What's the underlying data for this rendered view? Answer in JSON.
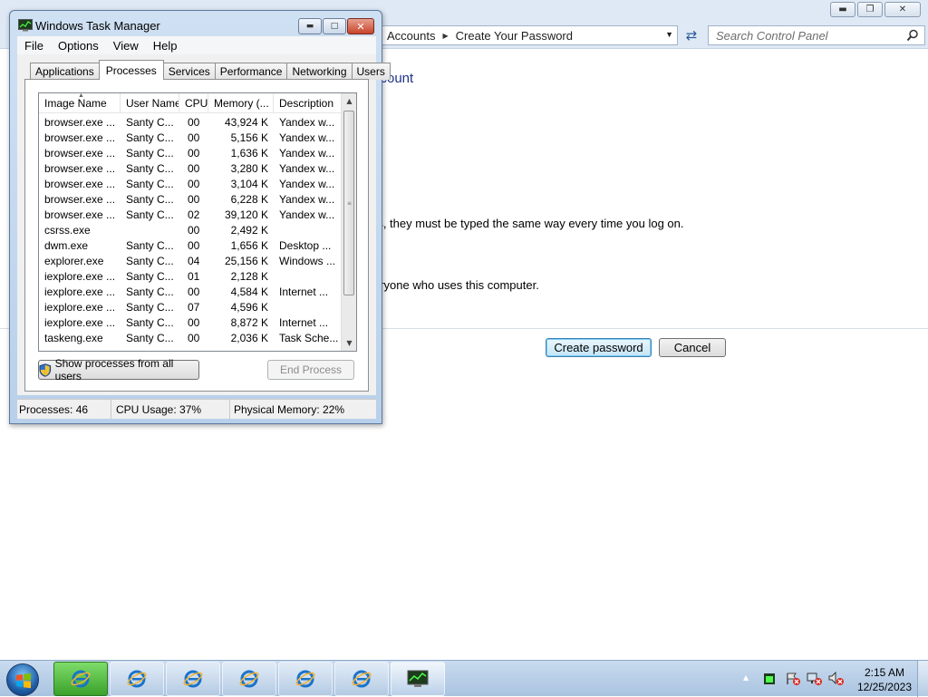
{
  "control_panel": {
    "breadcrumb": [
      "Accounts",
      "Create Your Password"
    ],
    "search_placeholder": "Search Control Panel",
    "heading_fragment": "ccount",
    "text_line1": "rs, they must be typed the same way every time you log on.",
    "text_line2": "eryone who uses this computer.",
    "create_password_label": "Create password",
    "cancel_label": "Cancel"
  },
  "task_manager": {
    "title": "Windows Task Manager",
    "menu": [
      "File",
      "Options",
      "View",
      "Help"
    ],
    "tabs": [
      "Applications",
      "Processes",
      "Services",
      "Performance",
      "Networking",
      "Users"
    ],
    "active_tab": "Processes",
    "columns": [
      "Image Name",
      "User Name",
      "CPU",
      "Memory (...",
      "Description"
    ],
    "rows": [
      {
        "name": "browser.exe ...",
        "user": "Santy C...",
        "cpu": "00",
        "mem": "43,924 K",
        "desc": "Yandex w..."
      },
      {
        "name": "browser.exe ...",
        "user": "Santy C...",
        "cpu": "00",
        "mem": "5,156 K",
        "desc": "Yandex w..."
      },
      {
        "name": "browser.exe ...",
        "user": "Santy C...",
        "cpu": "00",
        "mem": "1,636 K",
        "desc": "Yandex w..."
      },
      {
        "name": "browser.exe ...",
        "user": "Santy C...",
        "cpu": "00",
        "mem": "3,280 K",
        "desc": "Yandex w..."
      },
      {
        "name": "browser.exe ...",
        "user": "Santy C...",
        "cpu": "00",
        "mem": "3,104 K",
        "desc": "Yandex w..."
      },
      {
        "name": "browser.exe ...",
        "user": "Santy C...",
        "cpu": "00",
        "mem": "6,228 K",
        "desc": "Yandex w..."
      },
      {
        "name": "browser.exe ...",
        "user": "Santy C...",
        "cpu": "02",
        "mem": "39,120 K",
        "desc": "Yandex w..."
      },
      {
        "name": "csrss.exe",
        "user": "",
        "cpu": "00",
        "mem": "2,492 K",
        "desc": ""
      },
      {
        "name": "dwm.exe",
        "user": "Santy C...",
        "cpu": "00",
        "mem": "1,656 K",
        "desc": "Desktop ..."
      },
      {
        "name": "explorer.exe",
        "user": "Santy C...",
        "cpu": "04",
        "mem": "25,156 K",
        "desc": "Windows ..."
      },
      {
        "name": "iexplore.exe ...",
        "user": "Santy C...",
        "cpu": "01",
        "mem": "2,128 K",
        "desc": ""
      },
      {
        "name": "iexplore.exe ...",
        "user": "Santy C...",
        "cpu": "00",
        "mem": "4,584 K",
        "desc": "Internet ..."
      },
      {
        "name": "iexplore.exe ...",
        "user": "Santy C...",
        "cpu": "07",
        "mem": "4,596 K",
        "desc": ""
      },
      {
        "name": "iexplore.exe ...",
        "user": "Santy C...",
        "cpu": "00",
        "mem": "8,872 K",
        "desc": "Internet ..."
      },
      {
        "name": "taskeng.exe",
        "user": "Santy C...",
        "cpu": "00",
        "mem": "2,036 K",
        "desc": "Task Sche..."
      }
    ],
    "show_all_label": "Show processes from all users",
    "end_process_label": "End Process",
    "status": {
      "processes": "Processes: 46",
      "cpu": "CPU Usage: 37%",
      "memory": "Physical Memory: 22%"
    }
  },
  "taskbar": {
    "time": "2:15 AM",
    "date": "12/25/2023"
  }
}
